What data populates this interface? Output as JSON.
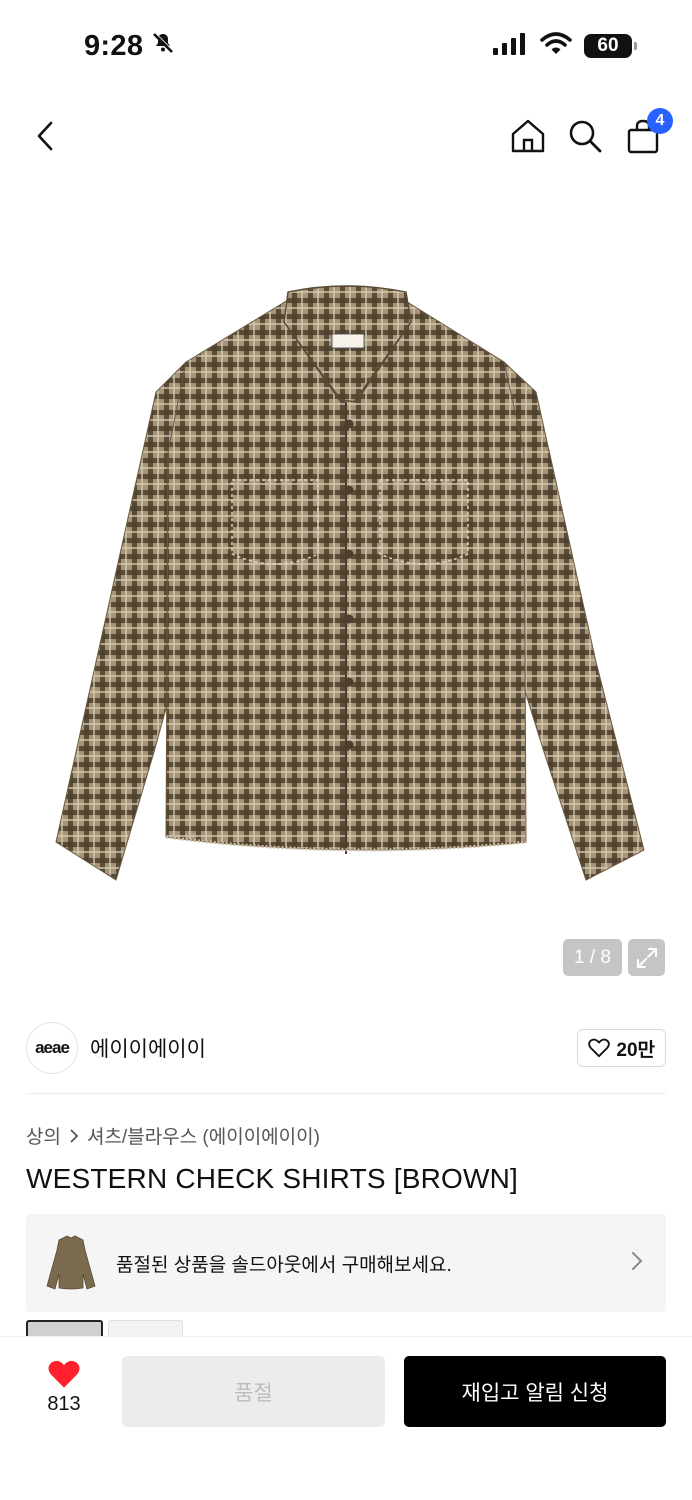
{
  "status_bar": {
    "time": "9:28",
    "battery": "60"
  },
  "nav": {
    "cart_count": "4"
  },
  "gallery": {
    "counter": "1 / 8"
  },
  "brand": {
    "logo_text": "aeae",
    "name": "에이이에이이",
    "likes": "20만"
  },
  "breadcrumb": {
    "category": "상의",
    "subcategory": "셔츠/블라우스 (에이이에이이)"
  },
  "product": {
    "title": "WESTERN CHECK SHIRTS [BROWN]"
  },
  "soldout_banner": {
    "text": "품절된 상품을 솔드아웃에서 구매해보세요."
  },
  "bottom_bar": {
    "heart_count": "813",
    "soldout_label": "품절",
    "restock_label": "재입고 알림 신청"
  },
  "colors": {
    "accent_blue": "#2761ff",
    "heart_red": "#ff1f2d",
    "shirt_brown": "#6f5f44"
  }
}
